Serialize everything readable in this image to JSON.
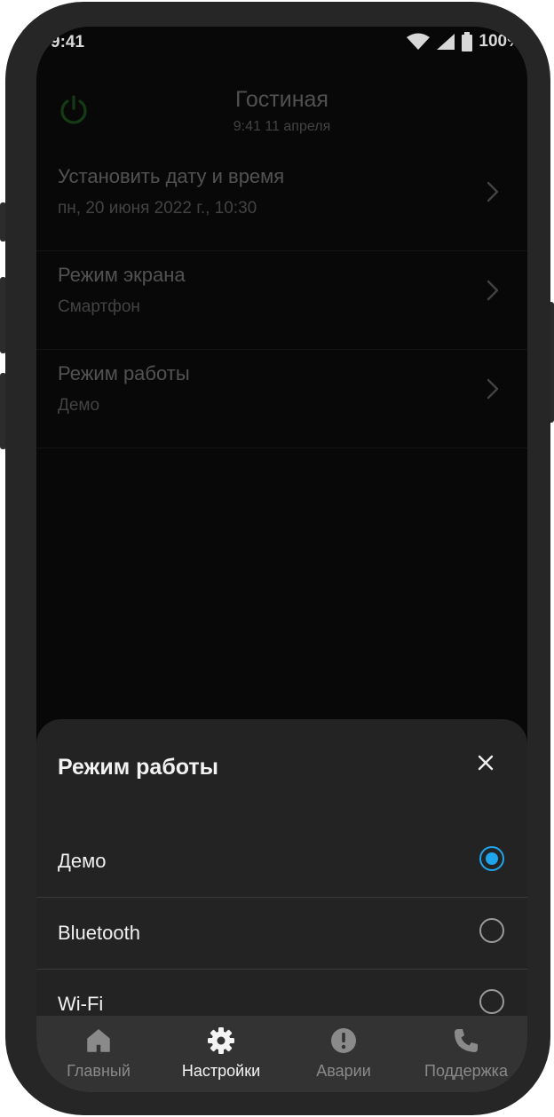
{
  "status_bar": {
    "time": "9:41",
    "battery": "100%"
  },
  "header": {
    "title": "Гостиная",
    "subtitle": "9:41 11 апреля"
  },
  "settings": [
    {
      "title": "Установить дату и время",
      "value": "пн, 20 июня 2022 г., 10:30"
    },
    {
      "title": "Режим экрана",
      "value": "Смартфон"
    },
    {
      "title": "Режим работы",
      "value": "Демо"
    }
  ],
  "sheet": {
    "title": "Режим работы",
    "options": [
      {
        "label": "Демо",
        "selected": true
      },
      {
        "label": "Bluetooth",
        "selected": false
      },
      {
        "label": "Wi-Fi",
        "selected": false
      }
    ]
  },
  "nav": {
    "items": [
      {
        "label": "Главный",
        "icon": "home-icon"
      },
      {
        "label": "Настройки",
        "icon": "gear-icon",
        "active": true
      },
      {
        "label": "Аварии",
        "icon": "alert-icon"
      },
      {
        "label": "Поддержка",
        "icon": "phone-icon"
      }
    ]
  },
  "colors": {
    "accent": "#1ea5ee",
    "power": "#2fa82f",
    "sheet_bg": "#232323",
    "nav_bg": "#333333"
  }
}
